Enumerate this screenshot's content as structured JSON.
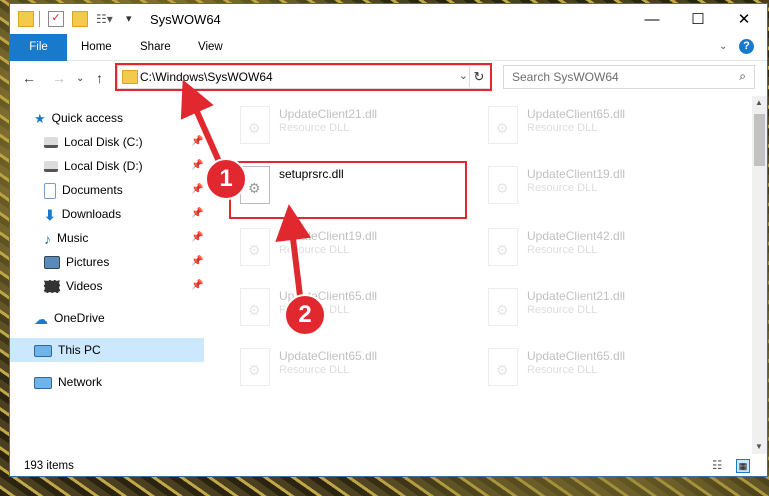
{
  "window": {
    "title": "SysWOW64"
  },
  "ribbon": {
    "tabs": [
      "File",
      "Home",
      "Share",
      "View"
    ]
  },
  "address": {
    "path": "C:\\Windows\\SysWOW64"
  },
  "search": {
    "placeholder": "Search SysWOW64"
  },
  "sidebar": {
    "items": [
      {
        "label": "Quick access",
        "icon": "star-icon"
      },
      {
        "label": "Local Disk (C:)",
        "icon": "drive-icon",
        "pinned": true
      },
      {
        "label": "Local Disk (D:)",
        "icon": "drive-icon",
        "pinned": true
      },
      {
        "label": "Documents",
        "icon": "document-icon",
        "pinned": true
      },
      {
        "label": "Downloads",
        "icon": "download-icon",
        "pinned": true
      },
      {
        "label": "Music",
        "icon": "music-icon",
        "pinned": true
      },
      {
        "label": "Pictures",
        "icon": "pictures-icon",
        "pinned": true
      },
      {
        "label": "Videos",
        "icon": "video-icon",
        "pinned": true
      },
      {
        "label": "OneDrive",
        "icon": "cloud-icon"
      },
      {
        "label": "This PC",
        "icon": "computer-icon",
        "selected": true
      },
      {
        "label": "Network",
        "icon": "network-icon"
      }
    ]
  },
  "files": [
    {
      "name": "UpdateClient21.dll",
      "type": "Resource DLL"
    },
    {
      "name": "UpdateClient65.dll",
      "type": "Resource DLL"
    },
    {
      "name": "setuprsrc.dll",
      "type": ""
    },
    {
      "name": "UpdateClient19.dll",
      "type": "Resource DLL"
    },
    {
      "name": "UpdateClient19.dll",
      "type": "Resource DLL"
    },
    {
      "name": "UpdateClient42.dll",
      "type": "Resource DLL"
    },
    {
      "name": "UpdateClient65.dll",
      "type": "Resource DLL"
    },
    {
      "name": "UpdateClient21.dll",
      "type": "Resource DLL"
    },
    {
      "name": "UpdateClient65.dll",
      "type": "Resource DLL"
    },
    {
      "name": "UpdateClient65.dll",
      "type": "Resource DLL"
    }
  ],
  "status": {
    "count": "193 items"
  },
  "callouts": [
    "1",
    "2"
  ],
  "colors": {
    "accent": "#1979ca",
    "highlight": "#e0282e",
    "selected": "#cce8ff"
  }
}
